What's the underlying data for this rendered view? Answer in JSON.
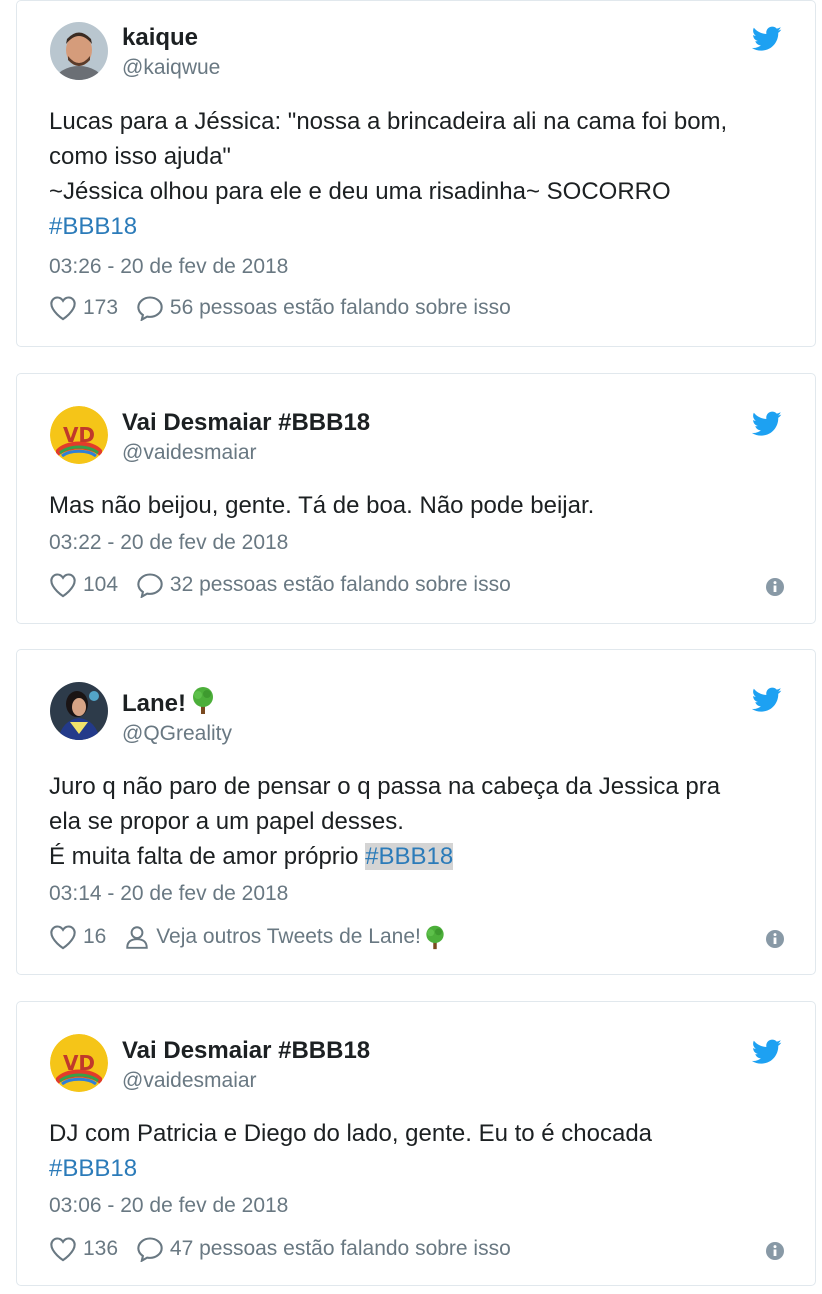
{
  "tweets": [
    {
      "name": "kaique",
      "handle": "@kaiqwue",
      "lines": [
        "Lucas para a Jéssica: \"nossa a brincadeira ali na cama foi bom,",
        "como isso ajuda\"",
        "~Jéssica olhou para ele e deu uma risadinha~ SOCORRO"
      ],
      "hashtag": "#BBB18",
      "time": "03:26 - 20 de fev de 2018",
      "likes": "173",
      "conversation": "56 pessoas estão falando sobre isso"
    },
    {
      "name": "Vai Desmaiar #BBB18",
      "handle": "@vaidesmaiar",
      "lines": [
        "Mas não beijou, gente. Tá de boa. Não pode beijar."
      ],
      "time": "03:22 - 20 de fev de 2018",
      "likes": "104",
      "conversation": "32 pessoas estão falando sobre isso"
    },
    {
      "name": "Lane!",
      "handle": "@QGreality",
      "lines": [
        "Juro q não paro de pensar o q passa na cabeça da Jessica pra",
        "ela se propor a um papel desses."
      ],
      "last_line_prefix": "É muita falta de amor próprio ",
      "hashtag": "#BBB18",
      "time": "03:14 - 20 de fev de 2018",
      "likes": "16",
      "profile_link": "Veja outros Tweets de Lane!"
    },
    {
      "name": "Vai Desmaiar #BBB18",
      "handle": "@vaidesmaiar",
      "lines": [
        "DJ com Patricia e Diego do lado, gente. Eu to é chocada"
      ],
      "hashtag": "#BBB18",
      "time": "03:06 - 20 de fev de 2018",
      "likes": "136",
      "conversation": "47 pessoas estão falando sobre isso"
    }
  ],
  "icons": {
    "twitter_bird": "twitter-bird-icon",
    "like": "heart-icon",
    "reply": "speech-bubble-icon",
    "profile": "person-icon",
    "info": "info-icon",
    "tree": "tree-emoji-icon"
  },
  "colors": {
    "twitter_blue": "#1da1f2",
    "hashtag": "#2b7bb9",
    "meta_gray": "#697882",
    "border": "#e1e8ed"
  }
}
